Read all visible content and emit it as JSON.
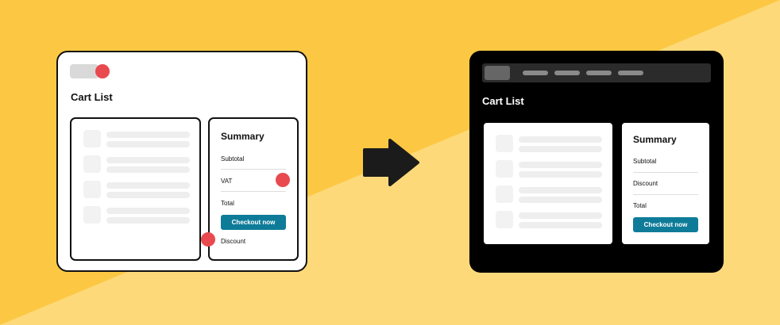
{
  "colors": {
    "background": "#fdd25e",
    "background_dark_band": "#fcc843",
    "background_light_band": "#fed97a",
    "accent_button": "#0e7c99",
    "annotation_dot": "#e84a4f",
    "dark_card": "#000000"
  },
  "before": {
    "page_title": "Cart List",
    "summary": {
      "title": "Summary",
      "rows": [
        "Subtotal",
        "VAT",
        "Total"
      ],
      "button_label": "Checkout now",
      "extra_label": "Discount"
    },
    "list_items": 4
  },
  "arrow": {
    "icon": "arrow-right-icon"
  },
  "after": {
    "page_title": "Cart List",
    "nav_links": 4,
    "summary": {
      "title": "Summary",
      "rows": [
        "Subtotal",
        "Discount",
        "Total"
      ],
      "button_label": "Checkout now"
    },
    "list_items": 4
  }
}
